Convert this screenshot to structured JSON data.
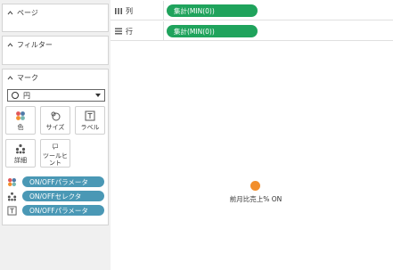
{
  "panels": {
    "pages": {
      "title": "ページ"
    },
    "filters": {
      "title": "フィルター"
    },
    "marks": {
      "title": "マーク",
      "mark_type": "円",
      "buttons": [
        {
          "label": "色",
          "icon": "color-icon"
        },
        {
          "label": "サイズ",
          "icon": "size-icon"
        },
        {
          "label": "ラベル",
          "icon": "label-icon"
        },
        {
          "label": "詳細",
          "icon": "detail-icon"
        },
        {
          "label": "ツールヒ\nント",
          "icon": "tooltip-icon"
        }
      ],
      "fields": [
        {
          "label": "ON/OFFパラメータ",
          "icon": "color-icon"
        },
        {
          "label": "ON/OFFセレクタ",
          "icon": "detail-icon"
        },
        {
          "label": "ON/OFFパラメータ",
          "icon": "label-icon"
        }
      ]
    }
  },
  "shelves": {
    "columns": {
      "label": "列",
      "pill": "集計(MIN(0))"
    },
    "rows": {
      "label": "行",
      "pill": "集計(MIN(0))"
    }
  },
  "view": {
    "mark_label": "前月比売上% ON",
    "mark_color": "#f28e2b"
  },
  "colors": {
    "shelf_pill": "#1fa35c",
    "marks_pill": "#4a98b5"
  }
}
